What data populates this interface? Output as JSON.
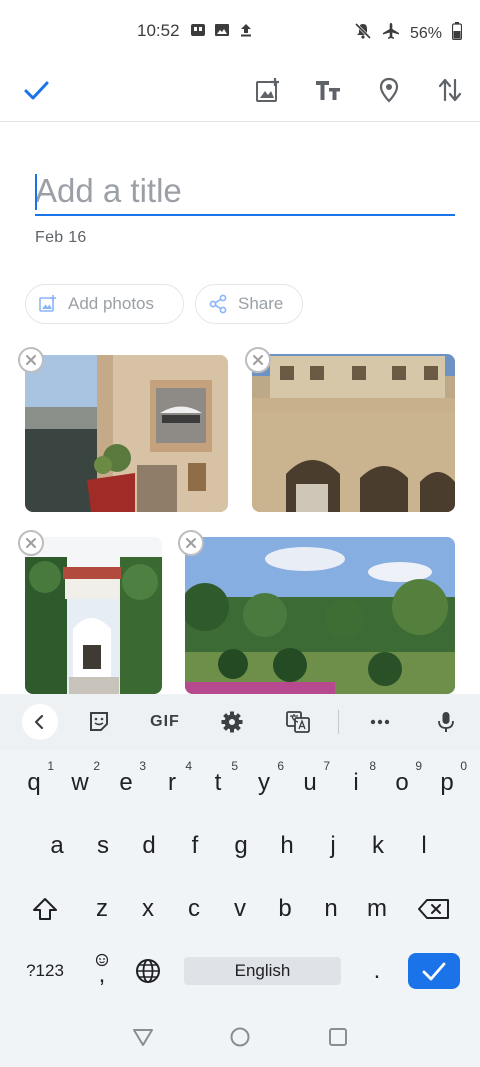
{
  "status_bar": {
    "time": "10:52",
    "battery": "56%"
  },
  "note": {
    "title_value": "",
    "title_placeholder": "Add a title",
    "date": "Feb 16"
  },
  "chips": {
    "add_photos": "Add photos",
    "share": "Share"
  },
  "keyboard": {
    "row1": [
      {
        "key": "q",
        "hint": "1"
      },
      {
        "key": "w",
        "hint": "2"
      },
      {
        "key": "e",
        "hint": "3"
      },
      {
        "key": "r",
        "hint": "4"
      },
      {
        "key": "t",
        "hint": "5"
      },
      {
        "key": "y",
        "hint": "6"
      },
      {
        "key": "u",
        "hint": "7"
      },
      {
        "key": "i",
        "hint": "8"
      },
      {
        "key": "o",
        "hint": "9"
      },
      {
        "key": "p",
        "hint": "0"
      }
    ],
    "row2": [
      "a",
      "s",
      "d",
      "f",
      "g",
      "h",
      "j",
      "k",
      "l"
    ],
    "row3": [
      "z",
      "x",
      "c",
      "v",
      "b",
      "n",
      "m"
    ],
    "symbols_label": "?123",
    "comma_label": ",",
    "space_label": "English",
    "period_label": ".",
    "gif_label": "GIF"
  },
  "colors": {
    "accent": "#1a73e8",
    "placeholder": "#9aa0a6",
    "keyboard_bg": "#f1f4f7"
  }
}
